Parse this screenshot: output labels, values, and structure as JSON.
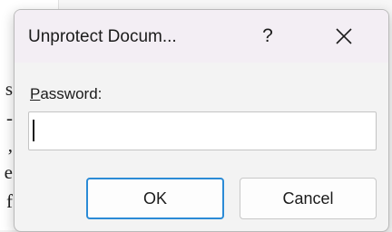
{
  "background": {
    "fragments": [
      "s",
      "-",
      ",",
      "e",
      "f"
    ]
  },
  "dialog": {
    "title": "Unprotect Docum...",
    "help_label": "?",
    "close_icon": "close-icon",
    "password_label_mnemonic": "P",
    "password_label_rest": "assword:",
    "password_value": "",
    "ok_label": "OK",
    "cancel_label": "Cancel"
  },
  "colors": {
    "titlebar": "#f3eef4",
    "focus_border": "#2b8bd6",
    "dialog_bg": "#f3f3f3"
  }
}
